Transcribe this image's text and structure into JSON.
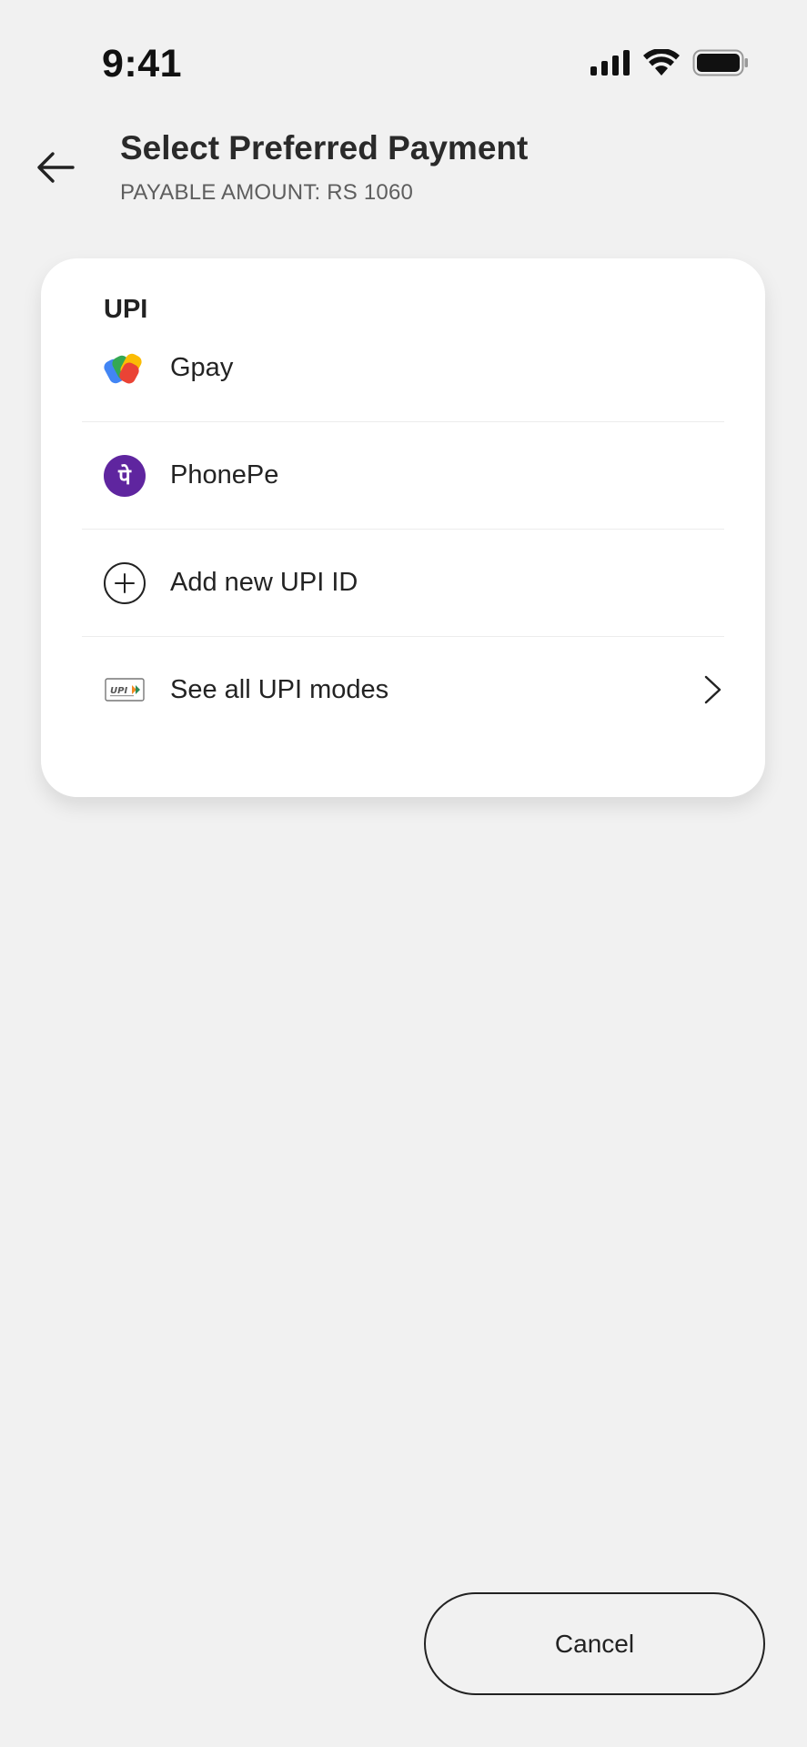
{
  "status_bar": {
    "time": "9:41",
    "icons": [
      "signal-icon",
      "wifi-icon",
      "battery-icon"
    ]
  },
  "header": {
    "back_icon": "arrow-left-icon",
    "title": "Select Preferred Payment",
    "subtitle": "PAYABLE AMOUNT: RS 1060"
  },
  "upi_section": {
    "title": "UPI",
    "options": [
      {
        "label": "Gpay",
        "icon": "gpay-icon"
      },
      {
        "label": "PhonePe",
        "icon": "phonepe-icon",
        "icon_glyph": "पे"
      },
      {
        "label": "Add new UPI ID",
        "icon": "plus-circle-icon"
      },
      {
        "label": "See all UPI modes",
        "icon": "upi-logo-icon",
        "trailing_icon": "chevron-right-icon"
      }
    ]
  },
  "footer": {
    "cancel_label": "Cancel"
  },
  "colors": {
    "background": "#f1f1f1",
    "card": "#ffffff",
    "phonepe_purple": "#5f259f",
    "text_primary": "#222222",
    "text_secondary": "#5e5e5e"
  }
}
